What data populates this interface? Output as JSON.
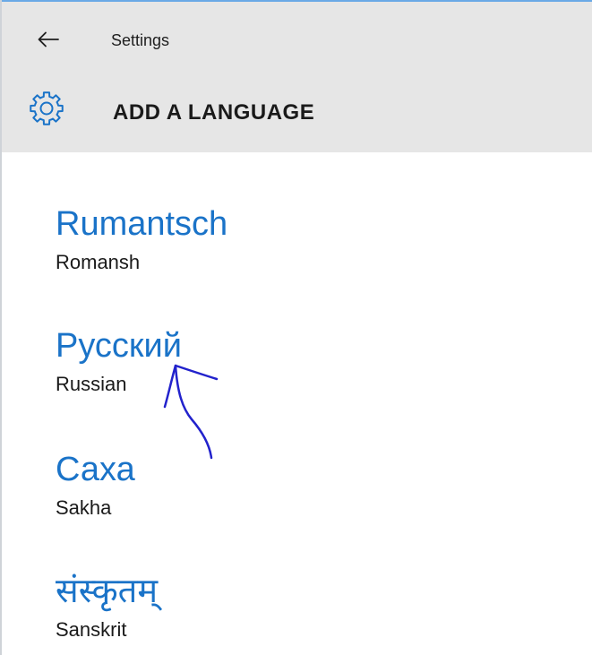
{
  "window": {
    "title": "Settings"
  },
  "page": {
    "title": "ADD A LANGUAGE"
  },
  "icons": {
    "back": "back-arrow-icon",
    "header": "gear-icon"
  },
  "colors": {
    "accent": "#1a73c8",
    "header_bg": "#e6e6e6",
    "annotation": "#2222cc"
  },
  "languages": [
    {
      "native": "Rumantsch",
      "english": "Romansh"
    },
    {
      "native": "Русский",
      "english": "Russian"
    },
    {
      "native": "Саха",
      "english": "Sakha"
    },
    {
      "native": "संस्कृतम्",
      "english": "Sanskrit"
    }
  ]
}
